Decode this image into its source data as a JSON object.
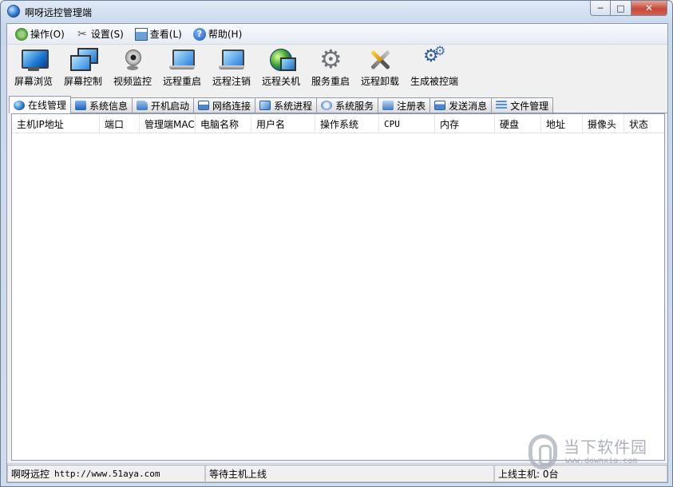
{
  "window": {
    "title": "啊呀远控管理端",
    "controls": {
      "minimize": "─",
      "maximize": "□",
      "close": "✕"
    }
  },
  "menu": [
    {
      "label": "操作(O)",
      "icon": "operate-icon"
    },
    {
      "label": "设置(S)",
      "icon": "settings-icon"
    },
    {
      "label": "查看(L)",
      "icon": "view-icon"
    },
    {
      "label": "帮助(H)",
      "icon": "help-icon"
    }
  ],
  "toolbar": [
    {
      "label": "屏幕浏览",
      "icon": "monitor-icon"
    },
    {
      "label": "屏幕控制",
      "icon": "dual-monitor-icon"
    },
    {
      "label": "视频监控",
      "icon": "webcam-icon"
    },
    {
      "label": "远程重启",
      "icon": "laptop-icon"
    },
    {
      "label": "远程注销",
      "icon": "laptop-logoff-icon"
    },
    {
      "label": "远程关机",
      "icon": "globe-monitor-icon"
    },
    {
      "label": "服务重启",
      "icon": "gear-icon"
    },
    {
      "label": "远程卸载",
      "icon": "tools-icon"
    },
    {
      "label": "生成被控端",
      "icon": "gears-icon"
    }
  ],
  "tabs": [
    {
      "label": "在线管理",
      "icon": "globe-icon",
      "active": true
    },
    {
      "label": "系统信息",
      "icon": "system-info-icon"
    },
    {
      "label": "开机启动",
      "icon": "startup-icon"
    },
    {
      "label": "网络连接",
      "icon": "network-icon"
    },
    {
      "label": "系统进程",
      "icon": "process-icon"
    },
    {
      "label": "系统服务",
      "icon": "service-icon"
    },
    {
      "label": "注册表",
      "icon": "registry-icon"
    },
    {
      "label": "发送消息",
      "icon": "message-icon"
    },
    {
      "label": "文件管理",
      "icon": "file-icon"
    }
  ],
  "table": {
    "columns": [
      "主机IP地址",
      "端口",
      "管理端MAC",
      "电脑名称",
      "用户名",
      "操作系统",
      "CPU",
      "内存",
      "硬盘",
      "地址",
      "摄像头",
      "状态"
    ],
    "rows": []
  },
  "status": {
    "app": "啊呀远控",
    "url": "http://www.51aya.com",
    "message": "等待主机上线",
    "online": "上线主机: 0台"
  },
  "watermark": {
    "text": "当下软件园",
    "url": "www.downxia.com"
  }
}
